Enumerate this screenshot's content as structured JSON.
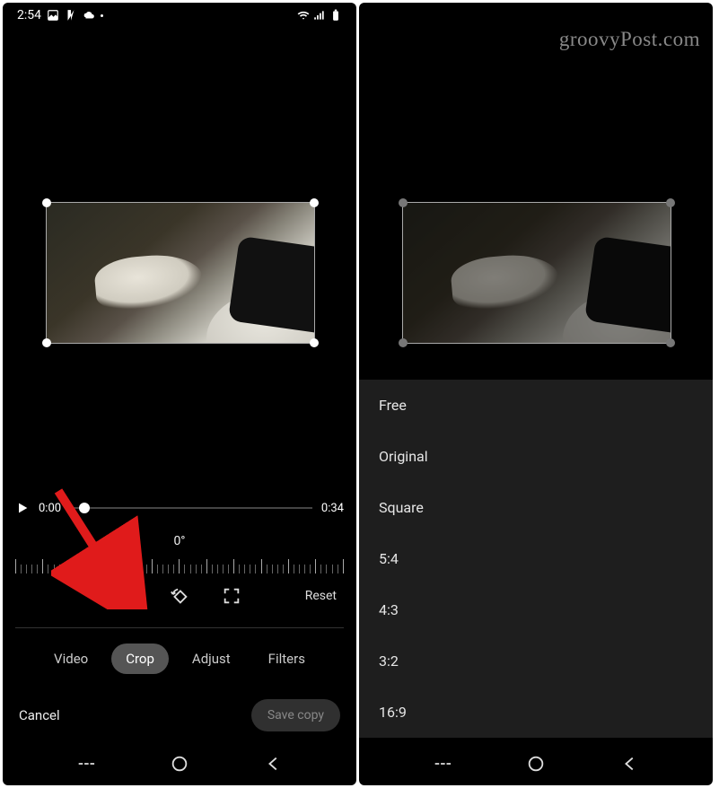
{
  "watermark": "groovyPost.com",
  "status": {
    "time": "2:54"
  },
  "playback": {
    "current": "0:00",
    "total": "0:34"
  },
  "rotation_label": "0°",
  "crop_tools": {
    "reset": "Reset"
  },
  "tabs": {
    "video": "Video",
    "crop": "Crop",
    "adjust": "Adjust",
    "filters": "Filters"
  },
  "actions": {
    "cancel": "Cancel",
    "save": "Save copy"
  },
  "aspect_options": {
    "free": "Free",
    "original": "Original",
    "square": "Square",
    "r54": "5:4",
    "r43": "4:3",
    "r32": "3:2",
    "r169": "16:9"
  }
}
